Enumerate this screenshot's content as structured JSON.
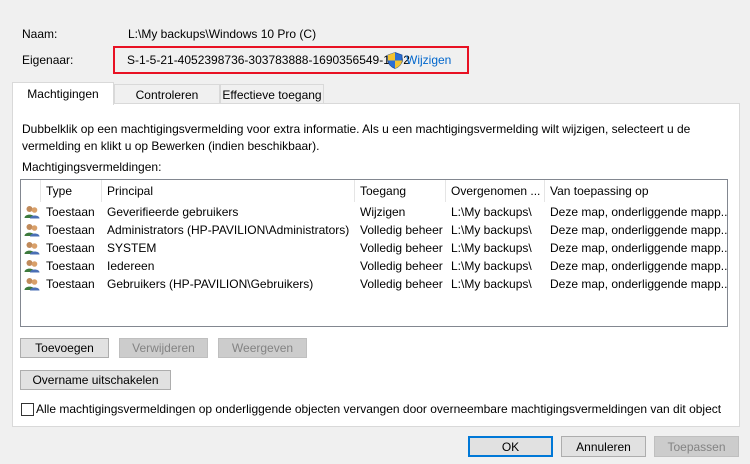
{
  "fields": {
    "name_label": "Naam:",
    "name_value": "L:\\My backups\\Windows 10 Pro (C)",
    "owner_label": "Eigenaar:",
    "owner_value": "S-1-5-21-4052398736-303783888-1690356549-1002",
    "change_link": "Wijzigen"
  },
  "tabs": [
    {
      "label": "Machtigingen",
      "active": true
    },
    {
      "label": "Controleren",
      "active": false
    },
    {
      "label": "Effectieve toegang",
      "active": false
    }
  ],
  "info_text": "Dubbelklik op een machtigingsvermelding voor extra informatie. Als u een machtigingsvermelding wilt wijzigen, selecteert u de vermelding en klikt u op Bewerken (indien beschikbaar).",
  "entries_label": "Machtigingsvermeldingen:",
  "table": {
    "columns": [
      "Type",
      "Principal",
      "Toegang",
      "Overgenomen ...",
      "Van toepassing op"
    ],
    "rows": [
      [
        "Toestaan",
        "Geverifieerde gebruikers",
        "Wijzigen",
        "L:\\My backups\\",
        "Deze map, onderliggende mapp..."
      ],
      [
        "Toestaan",
        "Administrators (HP-PAVILION\\Administrators)",
        "Volledig beheer",
        "L:\\My backups\\",
        "Deze map, onderliggende mapp..."
      ],
      [
        "Toestaan",
        "SYSTEM",
        "Volledig beheer",
        "L:\\My backups\\",
        "Deze map, onderliggende mapp..."
      ],
      [
        "Toestaan",
        "Iedereen",
        "Volledig beheer",
        "L:\\My backups\\",
        "Deze map, onderliggende mapp..."
      ],
      [
        "Toestaan",
        "Gebruikers (HP-PAVILION\\Gebruikers)",
        "Volledig beheer",
        "L:\\My backups\\",
        "Deze map, onderliggende mapp..."
      ]
    ]
  },
  "buttons": {
    "add": "Toevoegen",
    "remove": "Verwijderen",
    "view": "Weergeven",
    "disable_inheritance": "Overname uitschakelen",
    "ok": "OK",
    "cancel": "Annuleren",
    "apply": "Toepassen"
  },
  "replace_checkbox_label": "Alle machtigingsvermeldingen op onderliggende objecten vervangen door overneembare machtigingsvermeldingen van dit object",
  "colors": {
    "highlight_box": "#e81123",
    "link": "#0066cc",
    "default_button_border": "#0078d7"
  }
}
